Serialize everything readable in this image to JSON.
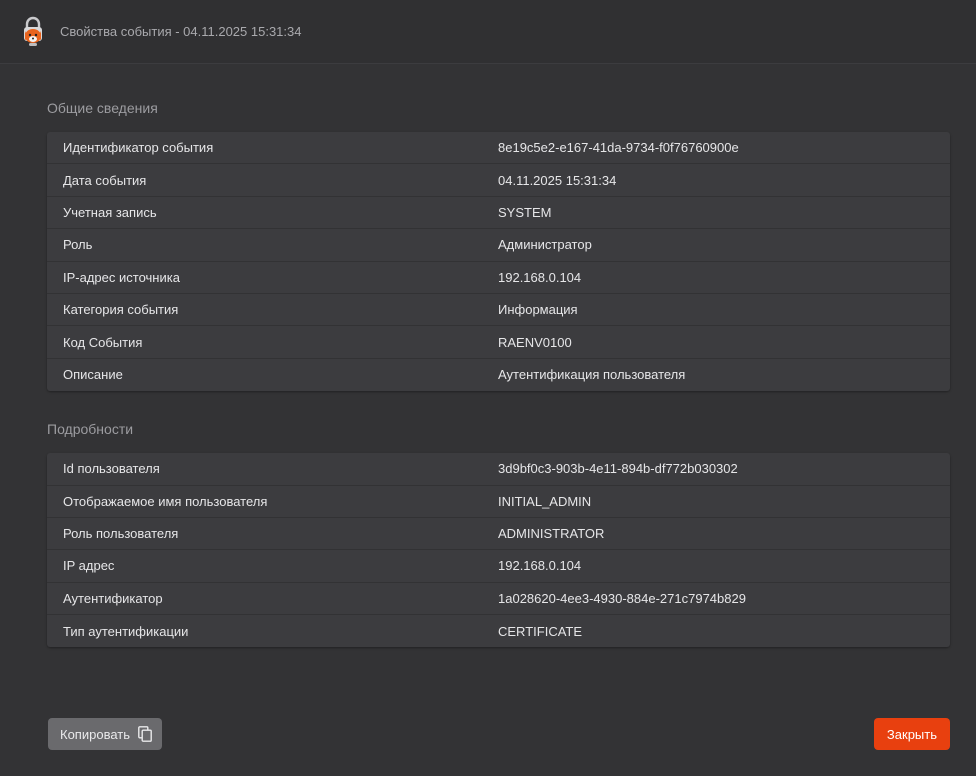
{
  "window": {
    "title": "Свойства события - 04.11.2025 15:31:34",
    "logo_icon": "lock-fox-logo-icon"
  },
  "general": {
    "title": "Общие сведения",
    "rows": [
      {
        "label": "Идентификатор события",
        "value": "8e19c5e2-e167-41da-9734-f0f76760900e"
      },
      {
        "label": "Дата события",
        "value": "04.11.2025 15:31:34"
      },
      {
        "label": "Учетная запись",
        "value": "SYSTEM"
      },
      {
        "label": "Роль",
        "value": "Администратор"
      },
      {
        "label": "IP-адрес источника",
        "value": "192.168.0.104"
      },
      {
        "label": "Категория события",
        "value": "Информация"
      },
      {
        "label": "Код События",
        "value": "RAENV0100"
      },
      {
        "label": "Описание",
        "value": "Аутентификация пользователя"
      }
    ]
  },
  "details": {
    "title": "Подробности",
    "rows": [
      {
        "label": "Id пользователя",
        "value": "3d9bf0c3-903b-4e11-894b-df772b030302"
      },
      {
        "label": "Отображаемое имя пользователя",
        "value": "INITIAL_ADMIN"
      },
      {
        "label": "Роль пользователя",
        "value": "ADMINISTRATOR"
      },
      {
        "label": "IP адрес",
        "value": "192.168.0.104"
      },
      {
        "label": "Аутентификатор",
        "value": "1a028620-4ee3-4930-884e-271c7974b829"
      },
      {
        "label": "Тип аутентификации",
        "value": "CERTIFICATE"
      }
    ]
  },
  "footer": {
    "copy_label": "Копировать",
    "copy_icon": "copy-icon",
    "close_label": "Закрыть"
  },
  "colors": {
    "accent": "#e8400f",
    "background": "#333335",
    "table": "#3c3c3f"
  }
}
